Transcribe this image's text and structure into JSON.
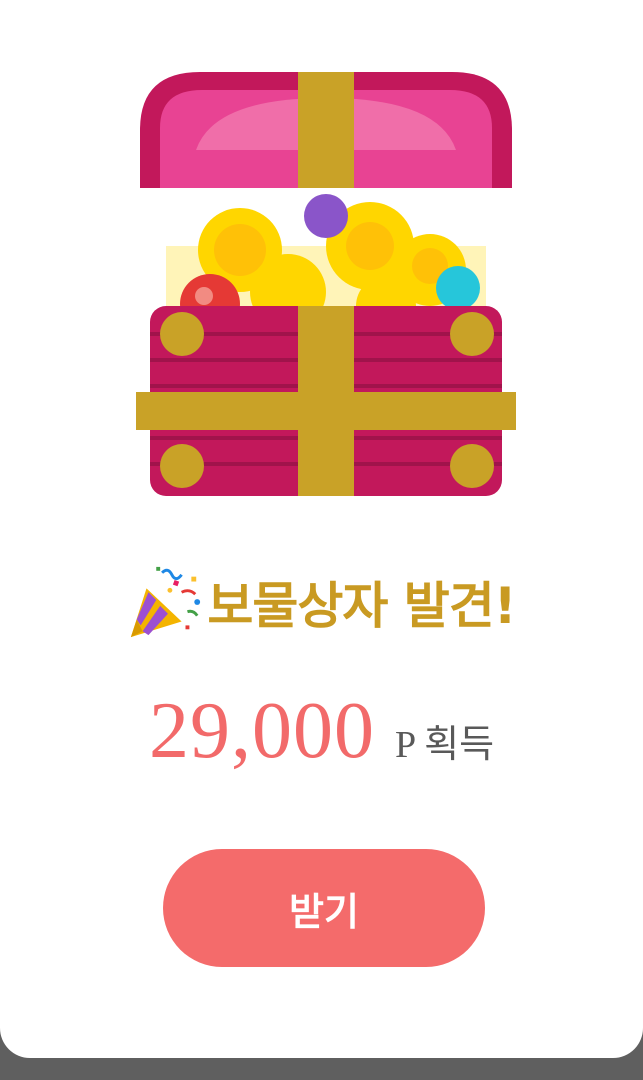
{
  "popup": {
    "title": "보물상자 발견!",
    "amount": "29,000",
    "unit": "P",
    "gain_text": "획득",
    "button_label": "받기"
  },
  "colors": {
    "title": "#c99a22",
    "amount": "#f26a6a",
    "button": "#f46b6b",
    "chest_body": "#c2185b",
    "chest_lid": "#e84393",
    "ribbon": "#c9a227",
    "coin": "#ffd600"
  },
  "icons": {
    "chest": "treasure-chest-icon",
    "popper": "party-popper-icon"
  }
}
